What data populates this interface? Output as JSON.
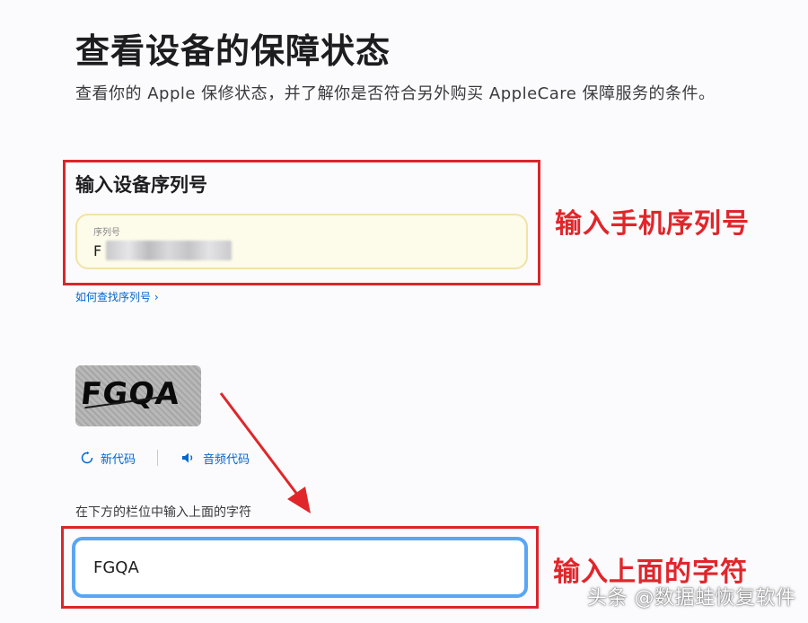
{
  "page": {
    "title": "查看设备的保障状态",
    "subtitle": "查看你的 Apple 保修状态，并了解你是否符合另外购买 AppleCare 保障服务的条件。"
  },
  "serial_section": {
    "heading": "输入设备序列号",
    "field_label": "序列号",
    "field_value": "F",
    "help_link": "如何查找序列号 ›"
  },
  "captcha": {
    "image_text": "FGQA",
    "new_code_label": "新代码",
    "audio_code_label": "音频代码",
    "instruction": "在下方的栏位中输入上面的字符",
    "input_value": "FGQA"
  },
  "annotations": {
    "serial_note": "输入手机序列号",
    "captcha_note": "输入上面的字符",
    "highlight_color": "#d9262b"
  },
  "watermark": "头条 @数据蛙恢复软件",
  "icons": {
    "refresh": "refresh-icon",
    "speaker": "speaker-icon"
  }
}
